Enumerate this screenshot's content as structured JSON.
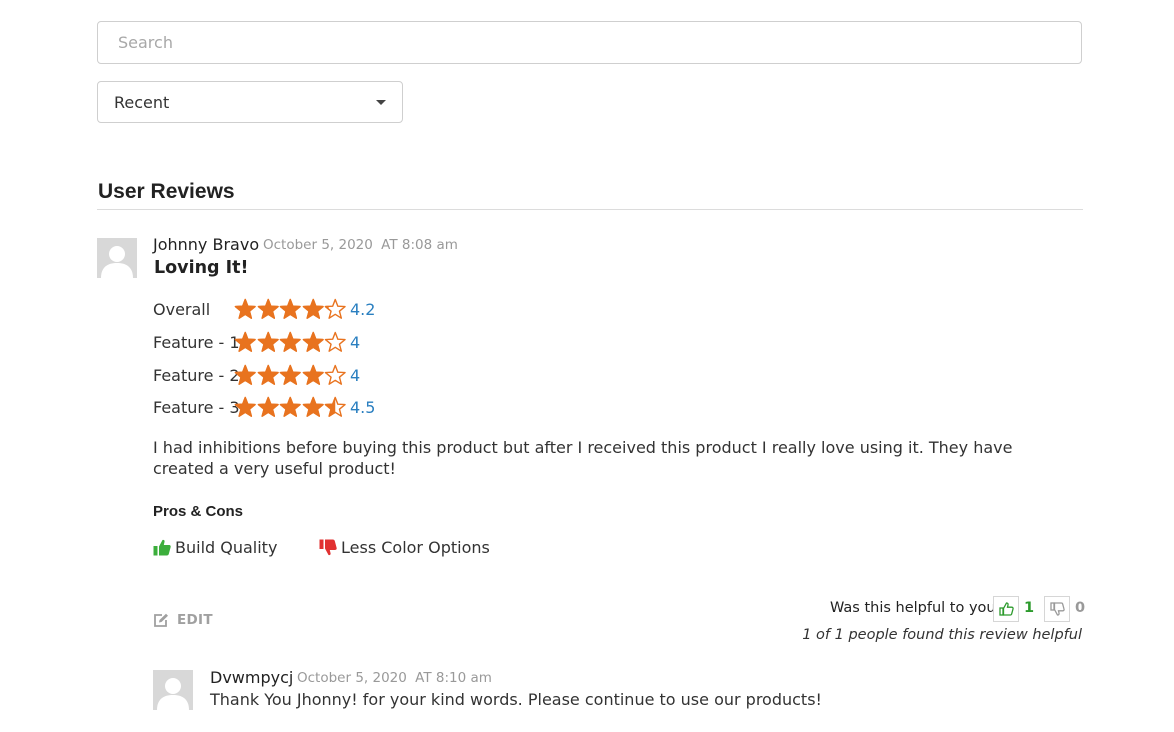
{
  "search": {
    "placeholder": "Search",
    "value": ""
  },
  "sort": {
    "selected": "Recent",
    "icon": "chevron-down-icon"
  },
  "section_title": "User Reviews",
  "colors": {
    "star": "#e8731f",
    "rating_value": "#2a7fc0",
    "pro": "#3cae3c",
    "con": "#e13131",
    "helpful_yes": "#2c9a2c",
    "helpful_no": "#999999"
  },
  "review": {
    "author": "Johnny Bravo",
    "date": "October 5, 2020",
    "time": "AT 8:08 am",
    "title": "Loving It!",
    "ratings": [
      {
        "label": "Overall",
        "value": "4.2",
        "score": 4.2
      },
      {
        "label": "Feature - 1",
        "value": "4",
        "score": 4
      },
      {
        "label": "Feature - 2",
        "value": "4",
        "score": 4
      },
      {
        "label": "Feature - 3",
        "value": "4.5",
        "score": 4.5
      }
    ],
    "body": "I had inhibitions before buying this product but after I received this product I really love using it. They have created a very useful product!",
    "pros_cons_heading": "Pros & Cons",
    "pro": {
      "text": "Build Quality",
      "icon": "thumbs-up-icon"
    },
    "con": {
      "text": "Less Color Options",
      "icon": "thumbs-down-icon"
    },
    "edit_label": "EDIT",
    "helpful": {
      "question": "Was this helpful to you ?",
      "yes_count": "1",
      "no_count": "0",
      "summary": "1 of 1 people found this review helpful"
    }
  },
  "reply": {
    "author": "Dvwmpycj",
    "date": "October 5, 2020",
    "time": "AT 8:10 am",
    "text": "Thank You Jhonny! for your kind words. Please continue to use our products!"
  }
}
